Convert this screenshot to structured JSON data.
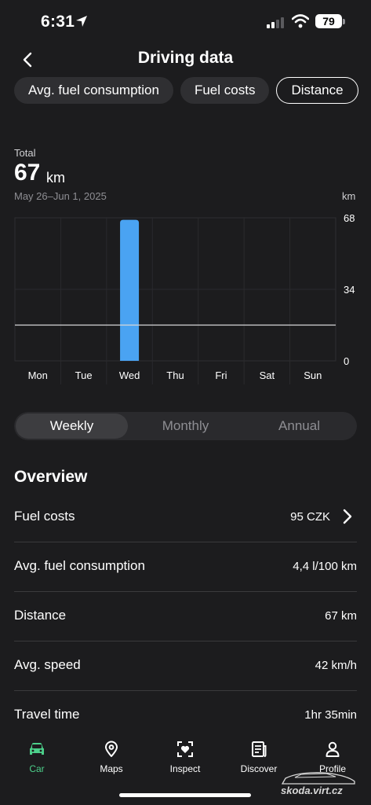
{
  "status_bar": {
    "time": "6:31",
    "battery": "79"
  },
  "header": {
    "title": "Driving data"
  },
  "filters": [
    "Avg. fuel consumption",
    "Fuel costs",
    "Distance"
  ],
  "summary": {
    "label": "Total",
    "value": "67",
    "unit": "km",
    "date_range": "May 26–Jun 1, 2025",
    "axis_unit": "km"
  },
  "chart_data": {
    "type": "bar",
    "categories": [
      "Mon",
      "Tue",
      "Wed",
      "Thu",
      "Fri",
      "Sat",
      "Sun"
    ],
    "values": [
      0,
      0,
      67,
      0,
      0,
      0,
      0
    ],
    "y_ticks": [
      "68",
      "34",
      "0"
    ],
    "ylim": [
      0,
      68
    ],
    "reference_line": 17,
    "bar_color": "#4aa3f2",
    "grid": true
  },
  "period_tabs": [
    "Weekly",
    "Monthly",
    "Annual"
  ],
  "overview": {
    "title": "Overview",
    "rows": [
      {
        "label": "Fuel costs",
        "value": "95 CZK"
      },
      {
        "label": "Avg. fuel consumption",
        "value": "4,4 l/100 km"
      },
      {
        "label": "Distance",
        "value": "67 km"
      },
      {
        "label": "Avg. speed",
        "value": "42 km/h"
      },
      {
        "label": "Travel time",
        "value": "1hr 35min"
      }
    ]
  },
  "tab_bar": [
    {
      "label": "Car",
      "icon": "car-icon",
      "active": true
    },
    {
      "label": "Maps",
      "icon": "map-pin-icon"
    },
    {
      "label": "Inspect",
      "icon": "inspect-icon"
    },
    {
      "label": "Discover",
      "icon": "newspaper-icon"
    },
    {
      "label": "Profile",
      "icon": "person-icon"
    }
  ],
  "watermark": "skoda.virt.cz",
  "colors": {
    "accent": "#4ccf8a",
    "bar": "#4aa3f2",
    "background": "#1c1c1e"
  }
}
